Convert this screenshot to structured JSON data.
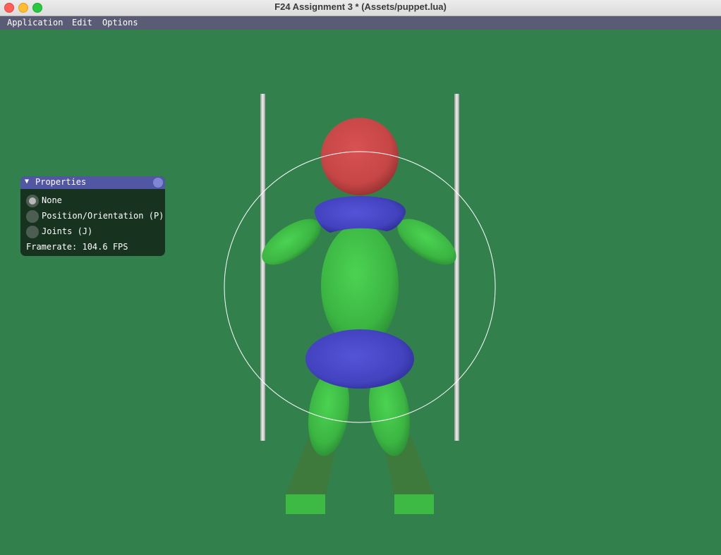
{
  "window": {
    "title": "F24 Assignment 3 * (Assets/puppet.lua)"
  },
  "menubar": {
    "items": [
      "Application",
      "Edit",
      "Options"
    ]
  },
  "properties_panel": {
    "title": "Properties",
    "modes": [
      {
        "label": "None",
        "selected": true
      },
      {
        "label": "Position/Orientation (P)",
        "selected": false
      },
      {
        "label": "Joints (J)",
        "selected": false
      }
    ],
    "framerate_text": "Framerate: 104.6 FPS"
  },
  "colors": {
    "background": "#32814d",
    "head": "#c94a4a",
    "body": "#3fbf45",
    "joint": "#4646c4",
    "pillar": "#d0d0d0",
    "trackball_circle": "#ffffff"
  }
}
